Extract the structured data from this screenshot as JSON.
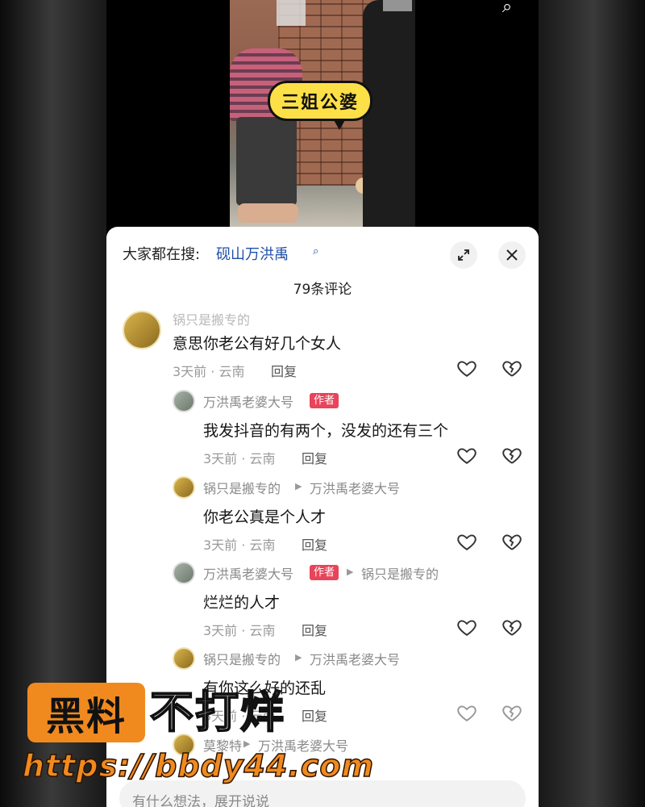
{
  "video": {
    "bubble_text": "三姐公婆"
  },
  "sheet": {
    "hot_label": "大家都在搜:",
    "hot_term": "砚山万洪禹",
    "comment_count": "79条评论"
  },
  "comments": [
    {
      "user": "锅只是搬专的",
      "text": "意思你老公有好几个女人",
      "meta": "3天前 · 云南",
      "reply_label": "回复"
    },
    {
      "user": "万洪禹老婆大号",
      "badge": "作者",
      "text": "我发抖音的有两个，没发的还有三个",
      "meta": "3天前 · 云南",
      "reply_label": "回复"
    },
    {
      "user": "锅只是搬专的",
      "reply_to": "万洪禹老婆大号",
      "text": "你老公真是个人才",
      "meta": "3天前 · 云南",
      "reply_label": "回复"
    },
    {
      "user": "万洪禹老婆大号",
      "badge": "作者",
      "reply_to": "锅只是搬专的",
      "text": "烂烂的人才",
      "meta": "3天前 · 云南",
      "reply_label": "回复"
    },
    {
      "user": "锅只是搬专的",
      "reply_to": "万洪禹老婆大号",
      "text": "有你这么好的还乱",
      "meta": "3天前 · 云南",
      "reply_label": "回复"
    },
    {
      "user": "莫黎特",
      "reply_to": "万洪禹老婆大号"
    }
  ],
  "input": {
    "placeholder": "有什么想法，展开说说"
  },
  "watermark": {
    "badge": "黑料",
    "text": "不打烊",
    "url": "https://bbdy44.com"
  },
  "colors": {
    "author_badge": "#e8445a",
    "link": "#1f4fa8",
    "watermark_orange": "#f08a1f"
  }
}
